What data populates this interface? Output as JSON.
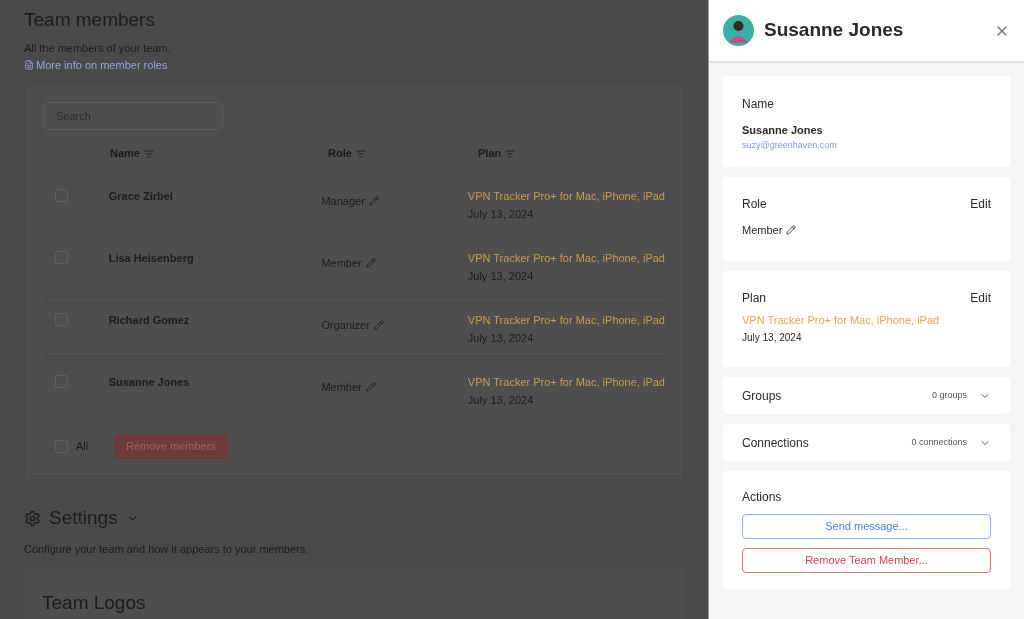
{
  "page": {
    "title": "Team members",
    "subtitle": "All the members of your team.",
    "roles_link": "More info on member roles"
  },
  "members_table": {
    "search": {
      "placeholder": "Search"
    },
    "columns": [
      "Name",
      "Role",
      "Plan"
    ],
    "rows": [
      {
        "name": "Grace Zirbel",
        "role": "Manager",
        "plan": "VPN Tracker Pro+ for Mac, iPhone, iPad",
        "date": "July 13, 2024",
        "checked": false
      },
      {
        "name": "Lisa Heisenberg",
        "role": "Member",
        "plan": "VPN Tracker Pro+ for Mac, iPhone, iPad",
        "date": "July 13, 2024",
        "checked": false
      },
      {
        "name": "Richard Gomez",
        "role": "Organizer",
        "plan": "VPN Tracker Pro+ for Mac, iPhone, iPad",
        "date": "July 13, 2024",
        "checked": false
      },
      {
        "name": "Susanne Jones",
        "role": "Member",
        "plan": "VPN Tracker Pro+ for Mac, iPhone, iPad",
        "date": "July 13, 2024",
        "checked": false
      }
    ],
    "select_all": {
      "label": "All",
      "checked": false
    },
    "remove_button": "Remove members"
  },
  "settings": {
    "title": "Settings",
    "subtitle": "Configure your team and how it appears to your members.",
    "section_title": "Team Logos"
  },
  "panel": {
    "title": "Susanne Jones",
    "name_card": {
      "label": "Name",
      "name": "Susanne Jones",
      "email": "suzy@greenhaven.com"
    },
    "role_card": {
      "label": "Role",
      "edit": "Edit",
      "role": "Member"
    },
    "plan_card": {
      "label": "Plan",
      "edit": "Edit",
      "plan": "VPN Tracker Pro+ for Mac, iPhone, iPad",
      "date": "July 13, 2024"
    },
    "groups": {
      "label": "Groups",
      "count": "0 groups",
      "expanded": false
    },
    "connections": {
      "label": "Connections",
      "count": "0 connections",
      "expanded": false
    },
    "actions": {
      "label": "Actions",
      "send": "Send message...",
      "remove": "Remove Team Member..."
    }
  }
}
